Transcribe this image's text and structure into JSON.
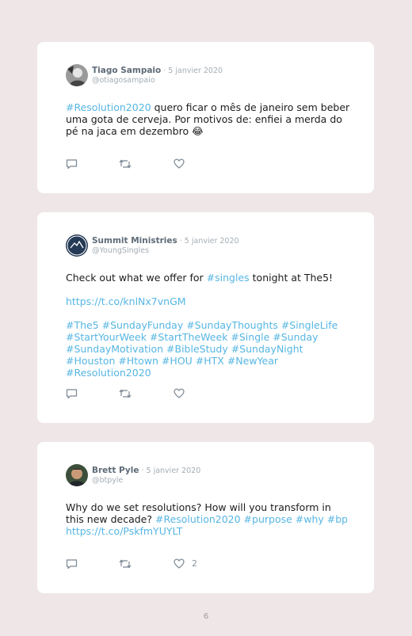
{
  "colors": {
    "background": "#efe6e7",
    "card": "#ffffff",
    "link": "#56b6e3",
    "name": "#5e6b77",
    "muted": "#a4adb5"
  },
  "tweets": [
    {
      "author": "Tiago Sampaio",
      "date": " · 5 janvier 2020",
      "handle": "@otiagosampaio",
      "body": [
        [
          {
            "t": "#Resolution2020",
            "link": true
          },
          {
            "t": " quero ficar o mês de janeiro sem beber uma gota de cerveja. Por motivos de: enfiei a merda do pé na jaca em dezembro 😂",
            "link": false
          }
        ]
      ],
      "likes": ""
    },
    {
      "author": "Summit Ministries",
      "date": " · 5 janvier 2020",
      "handle": "@YoungSingles",
      "body": [
        [
          {
            "t": "Check out what we offer for ",
            "link": false
          },
          {
            "t": "#singles",
            "link": true
          },
          {
            "t": " tonight at The5!",
            "link": false
          }
        ],
        [
          {
            "t": "https://t.co/knlNx7vnGM",
            "link": true
          }
        ],
        [
          {
            "t": "#The5 #SundayFunday #SundayThoughts #SingleLife #StartYourWeek #StartTheWeek #Single #Sunday #SundayMotivation #BibleStudy #SundayNight #Houston #Htown #HOU #HTX #NewYear #Resolution2020",
            "link": true
          }
        ]
      ],
      "likes": ""
    },
    {
      "author": "Brett Pyle",
      "date": " · 5 janvier 2020",
      "handle": "@btpyle",
      "body": [
        [
          {
            "t": "Why do we set resolutions? How will you transform in this new decade? ",
            "link": false
          },
          {
            "t": "#Resolution2020 #purpose #why #bp https://t.co/PskfmYUYLT",
            "link": true
          }
        ]
      ],
      "likes": "2"
    }
  ],
  "page_number": "6"
}
